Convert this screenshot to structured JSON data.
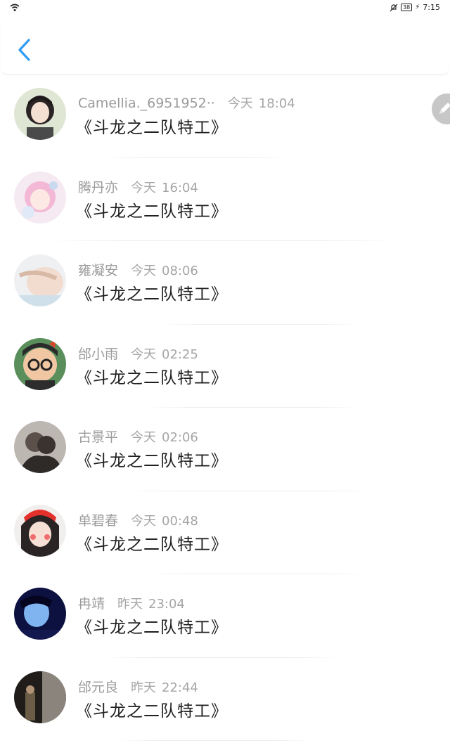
{
  "status_bar": {
    "battery": "38",
    "time": "7:15"
  },
  "header": {
    "back_icon": "chevron-left-icon",
    "accent_color": "#2f9bf2"
  },
  "comments": [
    {
      "name": "Camellia._6951952··",
      "day": "今天",
      "time": "18:04",
      "text": "《斗龙之二队特工》"
    },
    {
      "name": "腾丹亦",
      "day": "今天",
      "time": "16:04",
      "text": "《斗龙之二队特工》"
    },
    {
      "name": "雍凝安",
      "day": "今天",
      "time": "08:06",
      "text": "《斗龙之二队特工》"
    },
    {
      "name": "邰小雨",
      "day": "今天",
      "time": "02:25",
      "text": "《斗龙之二队特工》"
    },
    {
      "name": "古景平",
      "day": "今天",
      "time": "02:06",
      "text": "《斗龙之二队特工》"
    },
    {
      "name": "单碧春",
      "day": "今天",
      "time": "00:48",
      "text": "《斗龙之二队特工》"
    },
    {
      "name": "冉靖",
      "day": "昨天",
      "time": "23:04",
      "text": "《斗龙之二队特工》"
    },
    {
      "name": "邰元良",
      "day": "昨天",
      "time": "22:44",
      "text": "《斗龙之二队特工》"
    }
  ],
  "edit_button_icon": "pencil-icon"
}
